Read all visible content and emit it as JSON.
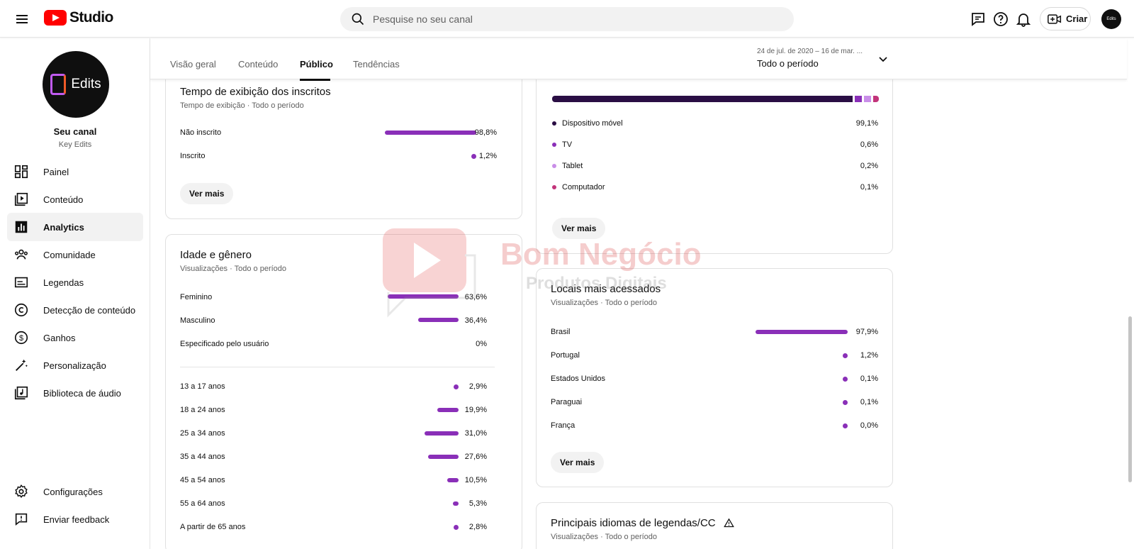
{
  "app": {
    "title": "Studio",
    "search_placeholder": "Pesquise no seu canal",
    "create_label": "Criar",
    "avatar_text": "Edits"
  },
  "sidebar": {
    "avatar_text": "Edits",
    "channel_name": "Seu canal",
    "channel_handle": "Key Edits",
    "items": [
      {
        "label": "Painel",
        "icon": "dashboard-icon"
      },
      {
        "label": "Conteúdo",
        "icon": "content-icon"
      },
      {
        "label": "Analytics",
        "icon": "analytics-icon",
        "active": true
      },
      {
        "label": "Comunidade",
        "icon": "community-icon"
      },
      {
        "label": "Legendas",
        "icon": "subtitles-icon"
      },
      {
        "label": "Detecção de conteúdo",
        "icon": "copyright-icon"
      },
      {
        "label": "Ganhos",
        "icon": "earn-icon"
      },
      {
        "label": "Personalização",
        "icon": "customization-icon"
      },
      {
        "label": "Biblioteca de áudio",
        "icon": "audio-library-icon"
      }
    ],
    "bottom": [
      {
        "label": "Configurações",
        "icon": "settings-icon"
      },
      {
        "label": "Enviar feedback",
        "icon": "feedback-icon"
      }
    ]
  },
  "tabs": [
    {
      "label": "Visão geral"
    },
    {
      "label": "Conteúdo"
    },
    {
      "label": "Público",
      "active": true
    },
    {
      "label": "Tendências"
    }
  ],
  "date": {
    "range": "24 de jul. de 2020 – 16 de mar. ...",
    "label": "Todo o período"
  },
  "subscribers_card": {
    "title": "Tempo de exibição dos inscritos",
    "subtitle": "Tempo de exibição · Todo o período",
    "rows": [
      {
        "label": "Não inscrito",
        "value": "98,8%",
        "fraction": 0.988
      },
      {
        "label": "Inscrito",
        "value": "1,2%",
        "fraction": 0.012
      }
    ],
    "button": "Ver mais"
  },
  "age_gender_card": {
    "title": "Idade e gênero",
    "subtitle": "Visualizações · Todo o período",
    "gender": [
      {
        "label": "Feminino",
        "value": "63,6%",
        "fraction": 0.636
      },
      {
        "label": "Masculino",
        "value": "36,4%",
        "fraction": 0.364
      },
      {
        "label": "Especificado pelo usuário",
        "value": "0%",
        "fraction": 0
      }
    ],
    "ages": [
      {
        "label": "13 a 17 anos",
        "value": "2,9%",
        "fraction": 0.029
      },
      {
        "label": "18 a 24 anos",
        "value": "19,9%",
        "fraction": 0.199
      },
      {
        "label": "25 a 34 anos",
        "value": "31,0%",
        "fraction": 0.31
      },
      {
        "label": "35 a 44 anos",
        "value": "27,6%",
        "fraction": 0.276
      },
      {
        "label": "45 a 54 anos",
        "value": "10,5%",
        "fraction": 0.105
      },
      {
        "label": "55 a 64 anos",
        "value": "5,3%",
        "fraction": 0.053
      },
      {
        "label": "A partir de 65 anos",
        "value": "2,8%",
        "fraction": 0.028
      }
    ]
  },
  "device_card": {
    "segments": [
      {
        "label": "Dispositivo móvel",
        "value": "99,1%",
        "color": "#2a0e44"
      },
      {
        "label": "TV",
        "value": "0,6%",
        "color": "#8a2fb8"
      },
      {
        "label": "Tablet",
        "value": "0,2%",
        "color": "#c98ee8"
      },
      {
        "label": "Computador",
        "value": "0,1%",
        "color": "#c2347a"
      }
    ],
    "button": "Ver mais"
  },
  "locations_card": {
    "title": "Locais mais acessados",
    "subtitle": "Visualizações · Todo o período",
    "rows": [
      {
        "label": "Brasil",
        "value": "97,9%",
        "fraction": 0.979
      },
      {
        "label": "Portugal",
        "value": "1,2%",
        "fraction": 0.012
      },
      {
        "label": "Estados Unidos",
        "value": "0,1%",
        "fraction": 0.001
      },
      {
        "label": "Paraguai",
        "value": "0,1%",
        "fraction": 0.001
      },
      {
        "label": "França",
        "value": "0,0%",
        "fraction": 0.0
      }
    ],
    "button": "Ver mais"
  },
  "languages_card": {
    "title": "Principais idiomas de legendas/CC",
    "subtitle": "Visualizações · Todo o período"
  },
  "watermark": {
    "brand": "Bom Negócio",
    "tagline": "Produtos Digitais"
  },
  "colors": {
    "accent": "#8a2fb8",
    "brand_red": "#ff0000"
  }
}
